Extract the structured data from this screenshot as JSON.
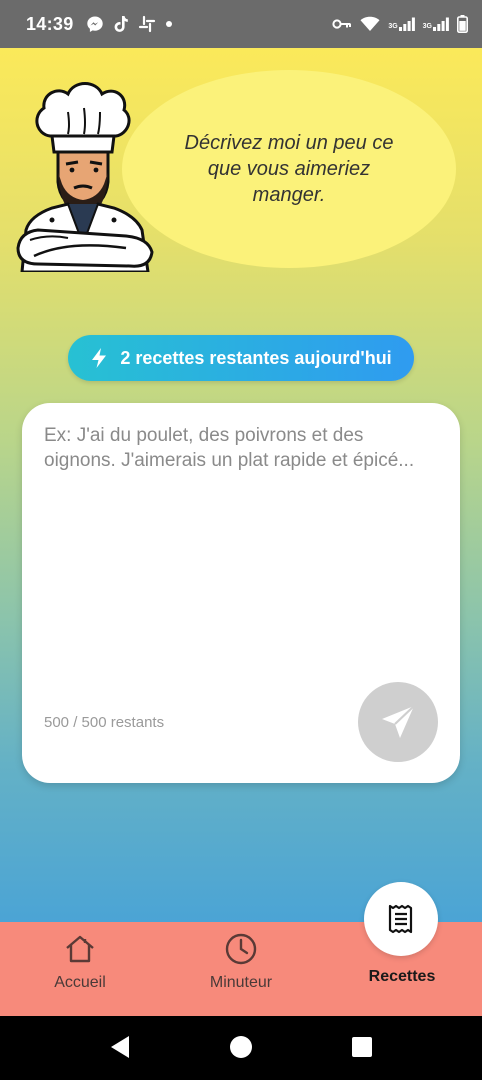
{
  "status_bar": {
    "time": "14:39",
    "left_icons": [
      "messenger-icon",
      "tiktok-icon",
      "slack-icon",
      "dot-icon"
    ],
    "right_icons": [
      "key-icon",
      "wifi-icon",
      "signal-3g-icon",
      "signal-3g-icon",
      "battery-icon"
    ],
    "network_label_1": "3G",
    "network_label_2": "3G"
  },
  "chef": {
    "speech": "Décrivez moi un peu ce que vous aimeriez manger."
  },
  "quota": {
    "icon": "bolt-icon",
    "label": "2 recettes restantes aujourd'hui"
  },
  "prompt": {
    "placeholder": "Ex: J'ai du poulet, des poivrons et des oignons. J'aimerais un plat rapide et épicé...",
    "value": "",
    "counter": "500 / 500 restants",
    "send_icon": "send-icon"
  },
  "nav": {
    "items": [
      {
        "label": "Accueil",
        "icon": "home-icon",
        "active": false
      },
      {
        "label": "Minuteur",
        "icon": "clock-icon",
        "active": false
      },
      {
        "label": "Recettes",
        "icon": "receipt-icon",
        "active": true
      }
    ]
  },
  "colors": {
    "gradient_top": "#fbe95a",
    "gradient_bottom": "#4ba4d5",
    "bubble": "#fbf27a",
    "pill_start": "#27c1d3",
    "pill_end": "#2f9bf0",
    "nav_bg": "#f78a7b"
  }
}
